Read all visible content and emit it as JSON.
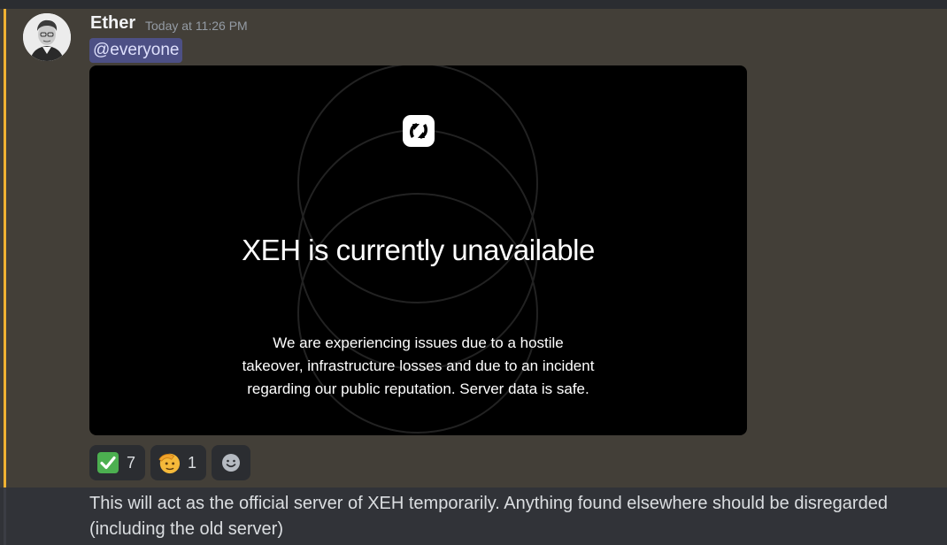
{
  "message": {
    "author": "Ether",
    "timestamp": "Today at 11:26 PM",
    "mention": "@everyone",
    "text": "This will act as the official server of XEH temporarily. Anything found elsewhere should be disregarded (including the old server)"
  },
  "attachment": {
    "headline": "XEH is currently unavailable",
    "body_lines": [
      "We are experiencing issues due to a hostile",
      "takeover, infrastructure losses and due to an incident",
      "regarding our public reputation. Server data is safe."
    ]
  },
  "reactions": [
    {
      "emoji": "white-check-mark",
      "count": "7"
    },
    {
      "emoji": "saluting-face",
      "count": "1"
    }
  ],
  "colors": {
    "highlight_bg": "#433f38",
    "highlight_bar": "#f0b232",
    "mention_bg": "#4d5085",
    "mention_text": "#dee0fc",
    "check_green": "#4caf50",
    "salute_yellow": "#f5b93a"
  }
}
